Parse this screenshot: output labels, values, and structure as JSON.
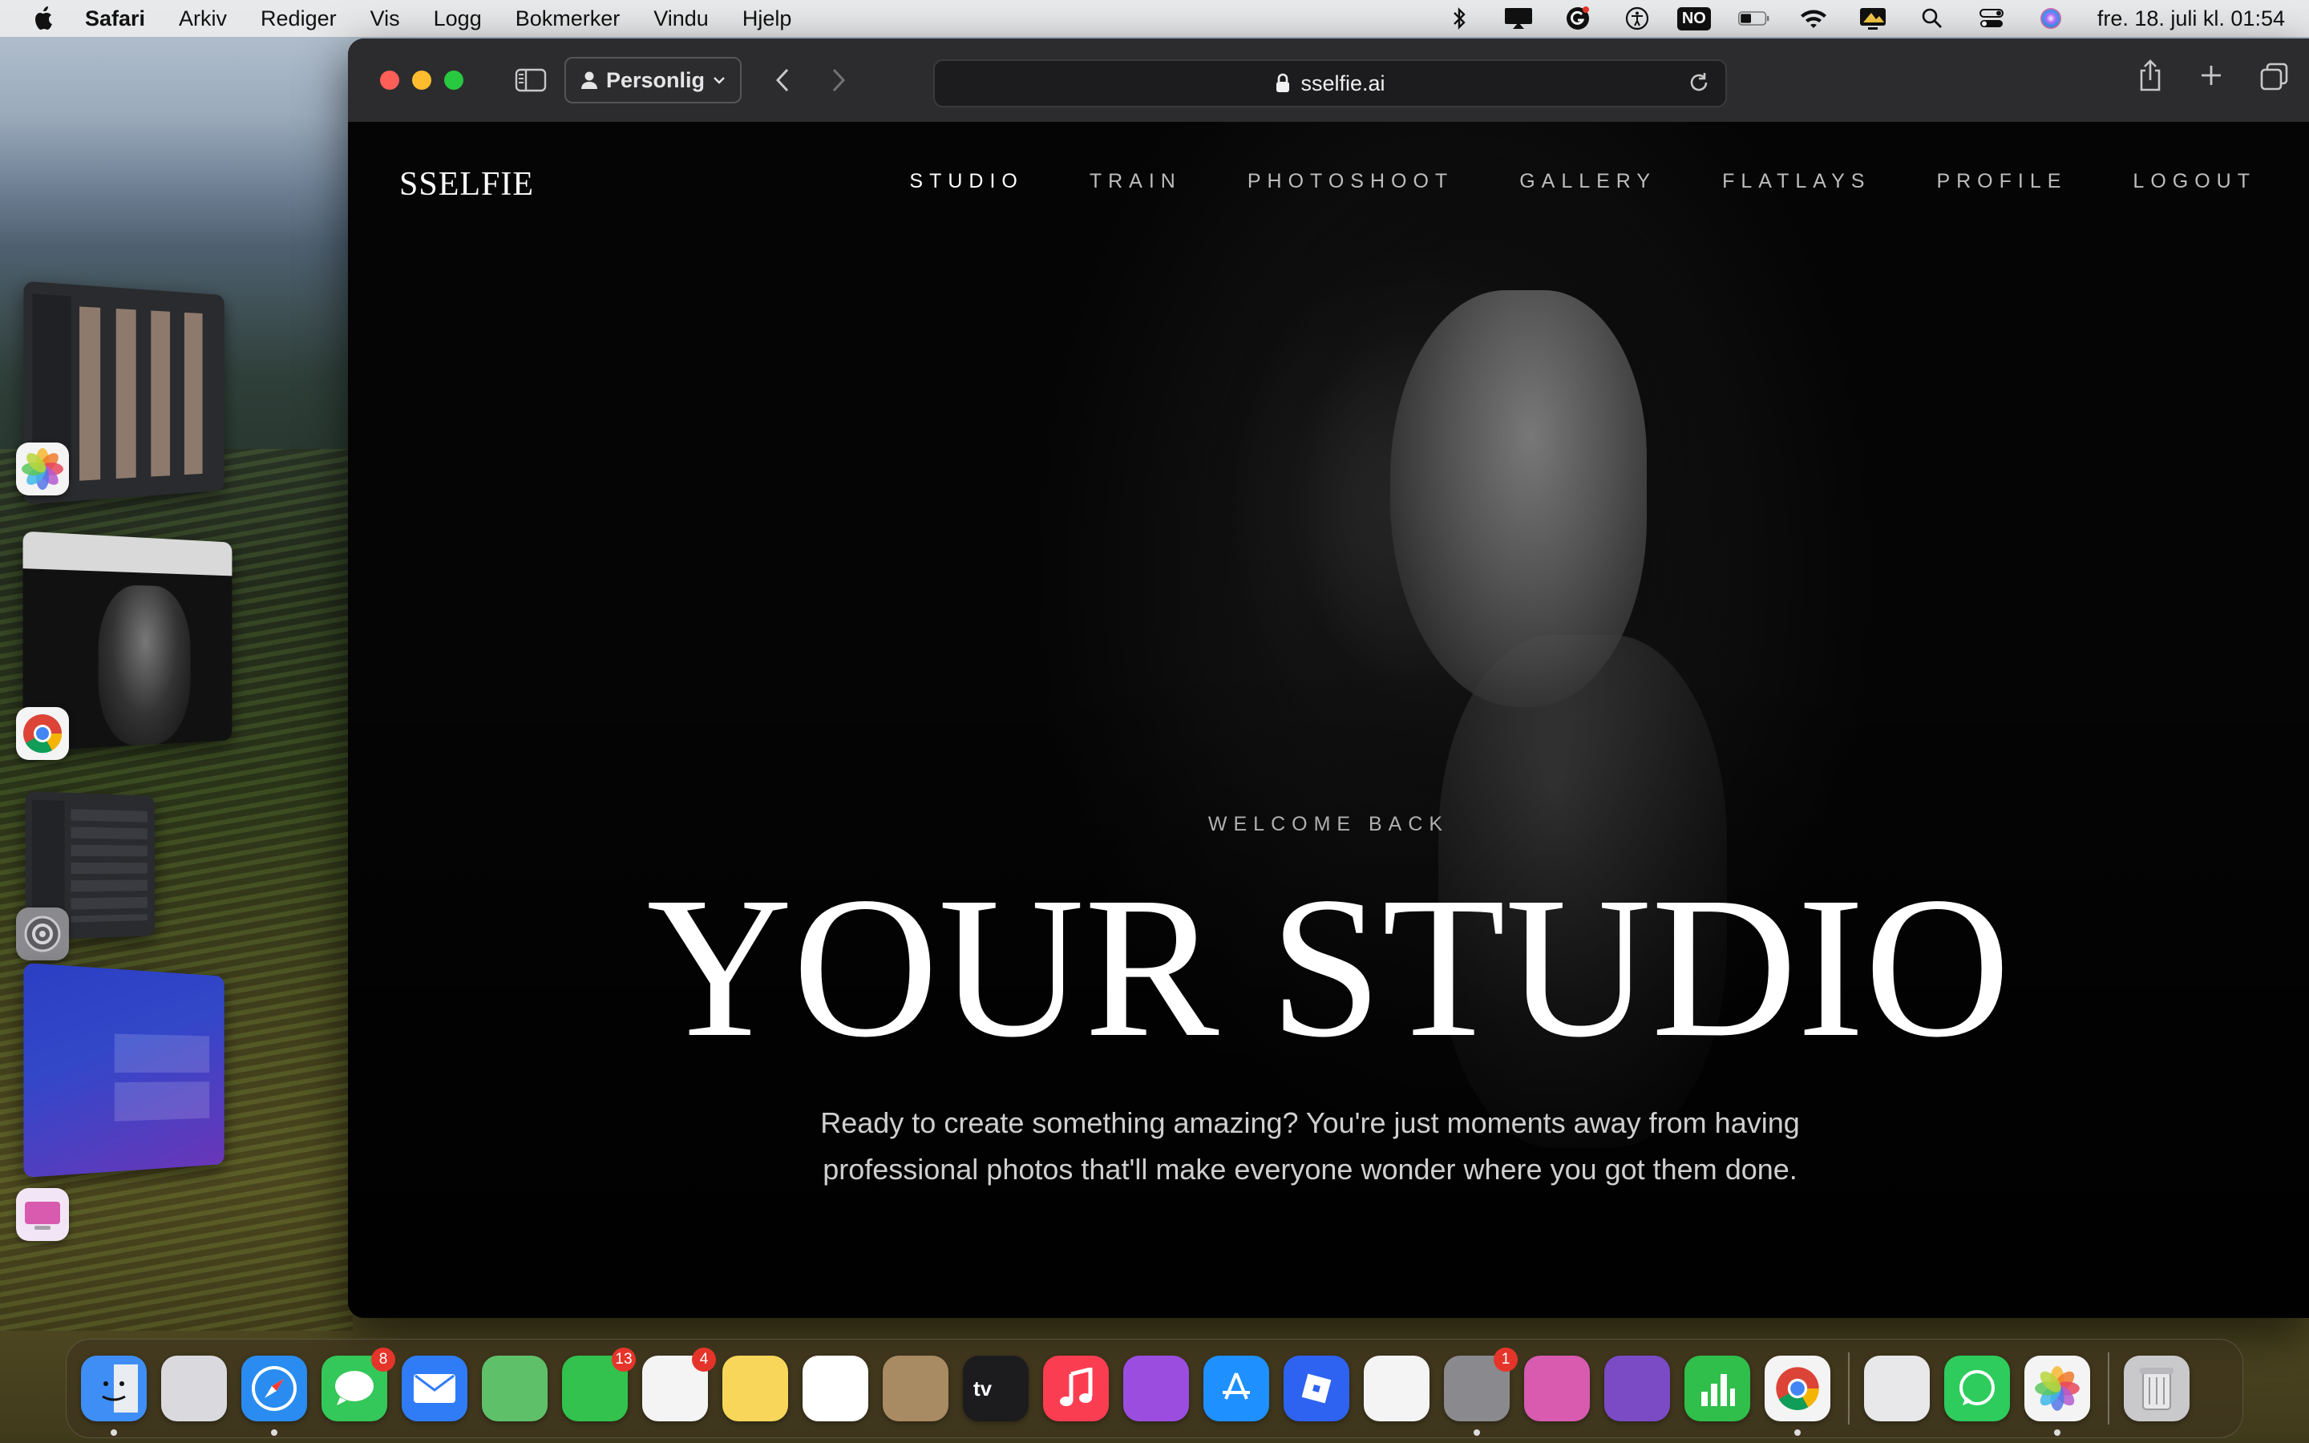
{
  "menubar": {
    "app": "Safari",
    "items": [
      "Arkiv",
      "Rediger",
      "Vis",
      "Logg",
      "Bokmerker",
      "Vindu",
      "Hjelp"
    ],
    "status_icons": [
      "bluetooth-icon",
      "airplay-icon",
      "grammarly-icon",
      "accessibility-icon",
      "input-source-badge",
      "battery-icon",
      "wifi-icon",
      "display-icon",
      "spotlight-icon",
      "control-center-icon",
      "siri-icon"
    ],
    "input_source": "NO",
    "clock": "fre. 18. juli kl. 01:54"
  },
  "safari": {
    "profile": "Personlig",
    "url": "sselfie.ai"
  },
  "site": {
    "logo": "SSELFIE",
    "nav": [
      "STUDIO",
      "TRAIN",
      "PHOTOSHOOT",
      "GALLERY",
      "FLATLAYS",
      "PROFILE",
      "LOGOUT"
    ],
    "active_nav": "STUDIO",
    "eyebrow": "WELCOME BACK",
    "title": "YOUR STUDIO",
    "subtitle_line1": "Ready to create something amazing? You're just moments away from having",
    "subtitle_line2": "professional photos that'll make everyone wonder where you got them done."
  },
  "stage_manager": {
    "apps": [
      "Photos",
      "Chrome",
      "System Settings",
      "CleanMyMac"
    ]
  },
  "dock": {
    "apps": [
      {
        "name": "Finder",
        "color": "#3f8ef5",
        "running": true
      },
      {
        "name": "Launchpad",
        "color": "#d9d9de"
      },
      {
        "name": "Safari",
        "color": "#2a8cf0",
        "running": true
      },
      {
        "name": "Messages",
        "color": "#34c759",
        "badge": "8"
      },
      {
        "name": "Mail",
        "color": "#2f7cf6"
      },
      {
        "name": "Maps",
        "color": "#5fc06a"
      },
      {
        "name": "FaceTime",
        "color": "#32c24d",
        "badge": "13"
      },
      {
        "name": "Reminders",
        "color": "#f4f4f4",
        "badge": "4"
      },
      {
        "name": "Notes",
        "color": "#f7d659"
      },
      {
        "name": "Freeform",
        "color": "#ffffff"
      },
      {
        "name": "Contacts",
        "color": "#a88a63"
      },
      {
        "name": "TV",
        "color": "#1c1c1e"
      },
      {
        "name": "Music",
        "color": "#fb3d52"
      },
      {
        "name": "Podcasts",
        "color": "#9b4de0"
      },
      {
        "name": "App Store",
        "color": "#1e90ff"
      },
      {
        "name": "Roblox",
        "color": "#2e63f1"
      },
      {
        "name": "Outlook",
        "color": "#f4f4f4"
      },
      {
        "name": "System Settings",
        "color": "#8a8a8e",
        "badge": "1",
        "running": true
      },
      {
        "name": "CleanMyMac",
        "color": "#d85bb0"
      },
      {
        "name": "GitHub Desktop",
        "color": "#7a4bc4"
      },
      {
        "name": "Numbers",
        "color": "#2fbf4a"
      },
      {
        "name": "Chrome",
        "color": "#f4f4f4",
        "running": true
      },
      {
        "name": "Preview",
        "color": "#e8e8ea"
      },
      {
        "name": "WhatsApp",
        "color": "#2ecc5d"
      },
      {
        "name": "Photos",
        "color": "#f4f4f4",
        "running": true
      },
      {
        "name": "Trash",
        "color": "#c9c9cc"
      }
    ]
  }
}
